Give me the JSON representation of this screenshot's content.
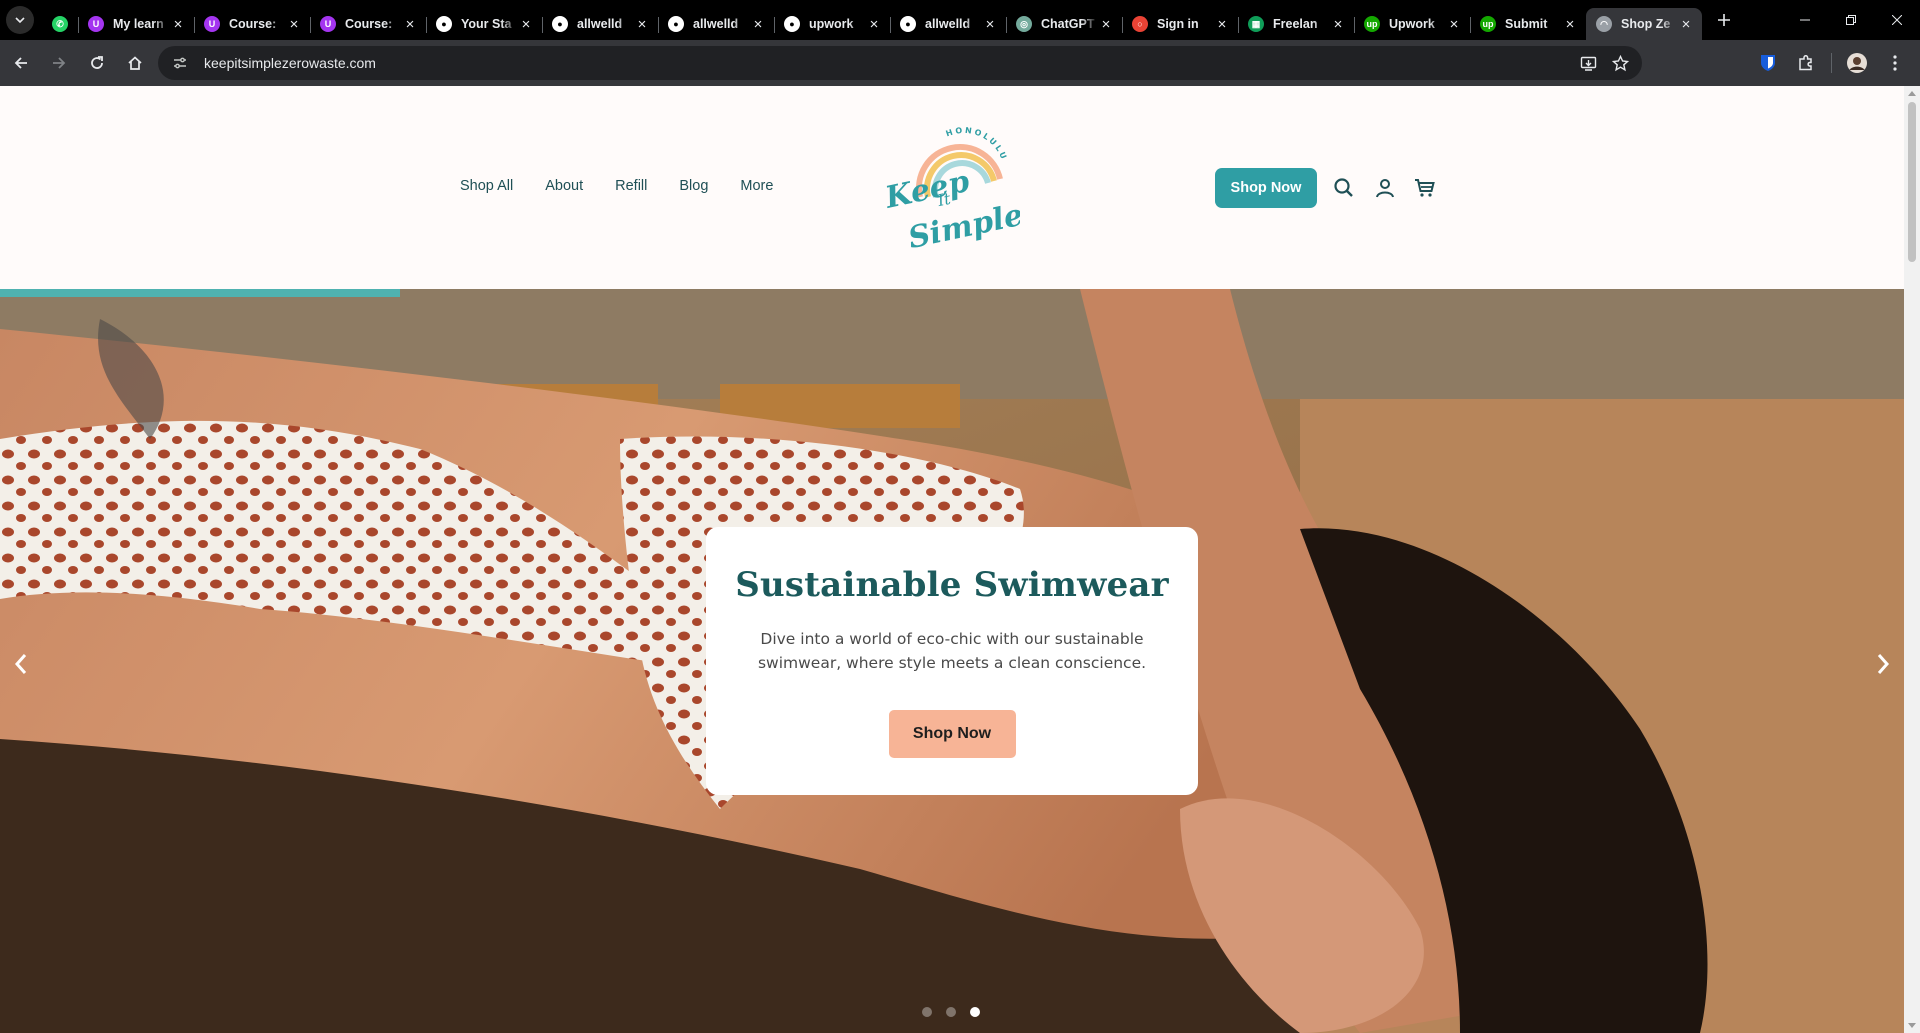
{
  "browser": {
    "tabs": [
      {
        "title": "",
        "icon": "whatsapp-icon",
        "color": "#25d366",
        "glyph": "✆",
        "pinned": true
      },
      {
        "title": "My learn",
        "icon": "udemy-icon",
        "color": "#a435f0",
        "glyph": "U"
      },
      {
        "title": "Course:",
        "icon": "udemy-icon",
        "color": "#a435f0",
        "glyph": "U"
      },
      {
        "title": "Course:",
        "icon": "udemy-icon",
        "color": "#a435f0",
        "glyph": "U"
      },
      {
        "title": "Your Sta",
        "icon": "github-icon",
        "color": "#ffffff",
        "glyph": "●"
      },
      {
        "title": "allwelld",
        "icon": "github-icon",
        "color": "#ffffff",
        "glyph": "●"
      },
      {
        "title": "allwelld",
        "icon": "github-icon",
        "color": "#ffffff",
        "glyph": "●"
      },
      {
        "title": "upwork",
        "icon": "github-icon",
        "color": "#ffffff",
        "glyph": "●"
      },
      {
        "title": "allwelld",
        "icon": "github-icon",
        "color": "#ffffff",
        "glyph": "●"
      },
      {
        "title": "ChatGPT",
        "icon": "chatgpt-icon",
        "color": "#74aa9c",
        "glyph": "◎"
      },
      {
        "title": "Sign in",
        "icon": "signin-icon",
        "color": "#ea4335",
        "glyph": "○"
      },
      {
        "title": "Freelan",
        "icon": "sheets-icon",
        "color": "#0f9d58",
        "glyph": "▦"
      },
      {
        "title": "Upwork",
        "icon": "upwork-icon",
        "color": "#14a800",
        "glyph": "up"
      },
      {
        "title": "Submit",
        "icon": "upwork-icon",
        "color": "#14a800",
        "glyph": "up"
      },
      {
        "title": "Shop Ze",
        "icon": "loading-icon",
        "color": "#9aa0a6",
        "glyph": "◠",
        "active": true
      }
    ],
    "url": "keepitsimplezerowaste.com"
  },
  "site": {
    "nav": [
      {
        "label": "Shop All"
      },
      {
        "label": "About"
      },
      {
        "label": "Refill"
      },
      {
        "label": "Blog"
      },
      {
        "label": "More"
      }
    ],
    "logo": {
      "line1": "Keep",
      "line2": "It",
      "line3": "Simple",
      "arc": "HONOLULU"
    },
    "header_button": "Shop Now",
    "brand_teal": "#2f9ea4",
    "hero": {
      "title": "Sustainable Swimwear",
      "subtitle": "Dive into a world of eco-chic with our sustainable swimwear, where style meets a clean conscience.",
      "button": "Shop Now",
      "button_color": "#f7b496",
      "slide_count": 3,
      "active_slide": 3
    }
  }
}
